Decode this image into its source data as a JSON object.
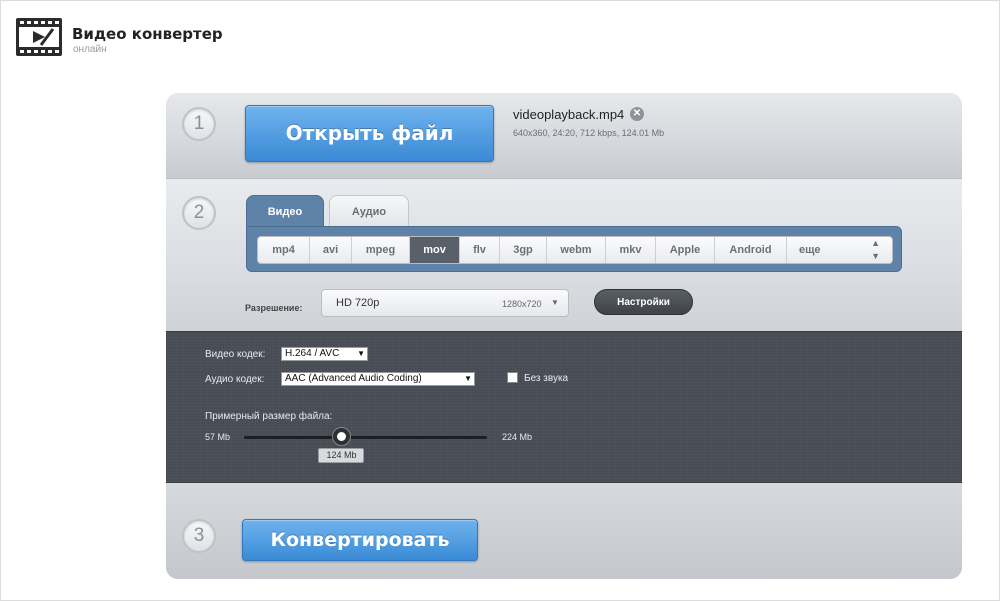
{
  "header": {
    "title": "Видео конвертер",
    "subtitle": "онлайн"
  },
  "step1": {
    "number": "1",
    "open_button": "Открыть файл",
    "file": {
      "name": "videoplayback.mp4",
      "info": "640x360, 24:20, 712 kbps, 124.01 Mb",
      "remove_glyph": "✕"
    }
  },
  "step2": {
    "number": "2",
    "tabs": [
      {
        "label": "Видео",
        "active": true
      },
      {
        "label": "Аудио",
        "active": false
      }
    ],
    "formats": [
      "mp4",
      "avi",
      "mpeg",
      "mov",
      "flv",
      "3gp",
      "webm",
      "mkv",
      "Apple",
      "Android",
      "еще"
    ],
    "active_format": "mov",
    "resolution": {
      "label": "Разрешение:",
      "value": "HD 720p",
      "dims": "1280x720"
    },
    "settings_button": "Настройки"
  },
  "advanced": {
    "video_codec": {
      "label": "Видео кодек:",
      "value": "H.264 / AVC"
    },
    "audio_codec": {
      "label": "Аудио кодек:",
      "value": "AAC (Advanced Audio Coding)"
    },
    "mute": {
      "label": "Без звука",
      "checked": false
    },
    "size": {
      "label": "Примерный размер файла:",
      "min": "57 Mb",
      "max": "224 Mb",
      "current": "124 Mb",
      "min_value": 57,
      "max_value": 224,
      "current_value": 124
    }
  },
  "step3": {
    "number": "3",
    "convert_button": "Конвертировать"
  },
  "colors": {
    "accent_blue": "#3a8ad6",
    "tab_blue": "#5f83a8",
    "dark_panel": "#4a4f57",
    "active_format": "#5a6069"
  }
}
